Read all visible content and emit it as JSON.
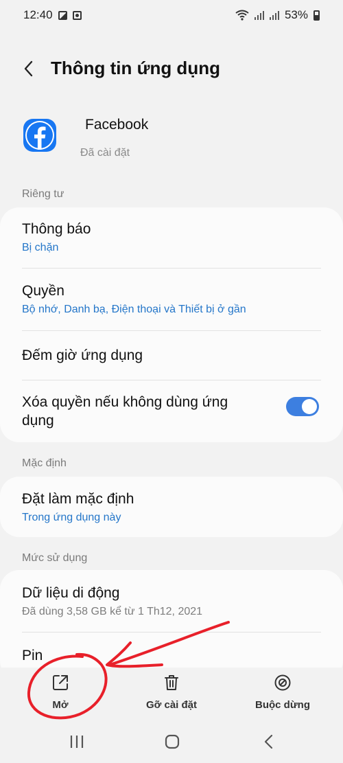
{
  "status_bar": {
    "time": "12:40",
    "battery": "53%"
  },
  "header": {
    "title": "Thông tin ứng dụng"
  },
  "app": {
    "name": "Facebook",
    "status": "Đã cài đặt"
  },
  "sections": {
    "privacy": "Riêng tư",
    "defaults": "Mặc định",
    "usage": "Mức sử dụng"
  },
  "privacy_items": {
    "notifications": {
      "title": "Thông báo",
      "sub": "Bị chặn"
    },
    "permissions": {
      "title": "Quyền",
      "sub": "Bộ nhớ, Danh bạ, Điện thoại và Thiết bị ở gần"
    },
    "screen_time": {
      "title": "Đếm giờ ứng dụng"
    },
    "remove_permissions": {
      "title_line1": "Xóa quyền nếu không dùng ứng",
      "title_line2": "dụng",
      "enabled": true
    }
  },
  "default_items": {
    "set_default": {
      "title": "Đặt làm mặc định",
      "sub": "Trong ứng dụng này"
    }
  },
  "usage_items": {
    "mobile_data": {
      "title": "Dữ liệu di động",
      "sub": "Đã dùng 3,58 GB kể từ 1 Th12, 2021"
    },
    "battery": {
      "title": "Pin"
    }
  },
  "actions": {
    "open": "Mở",
    "uninstall": "Gỡ cài đặt",
    "force_stop": "Buộc dừng"
  },
  "colors": {
    "accent_blue": "#2476c9",
    "toggle_blue": "#3d7fe0",
    "facebook_blue": "#1877f2",
    "annotation_red": "#e8202a"
  }
}
